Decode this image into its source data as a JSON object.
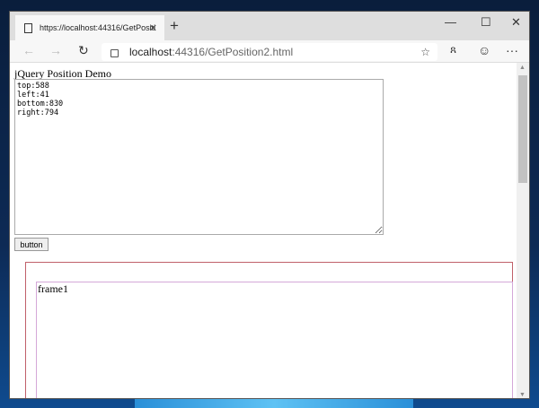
{
  "browser": {
    "tab_title": "https://localhost:44316/GetPositi",
    "url_host": "localhost",
    "url_rest": ":44316/GetPosition2.html"
  },
  "page": {
    "title": "jQuery Position Demo",
    "textarea_value": "top:588\nleft:41\nbottom:830\nright:794",
    "button_label": "button",
    "frame_text": "frame1"
  }
}
